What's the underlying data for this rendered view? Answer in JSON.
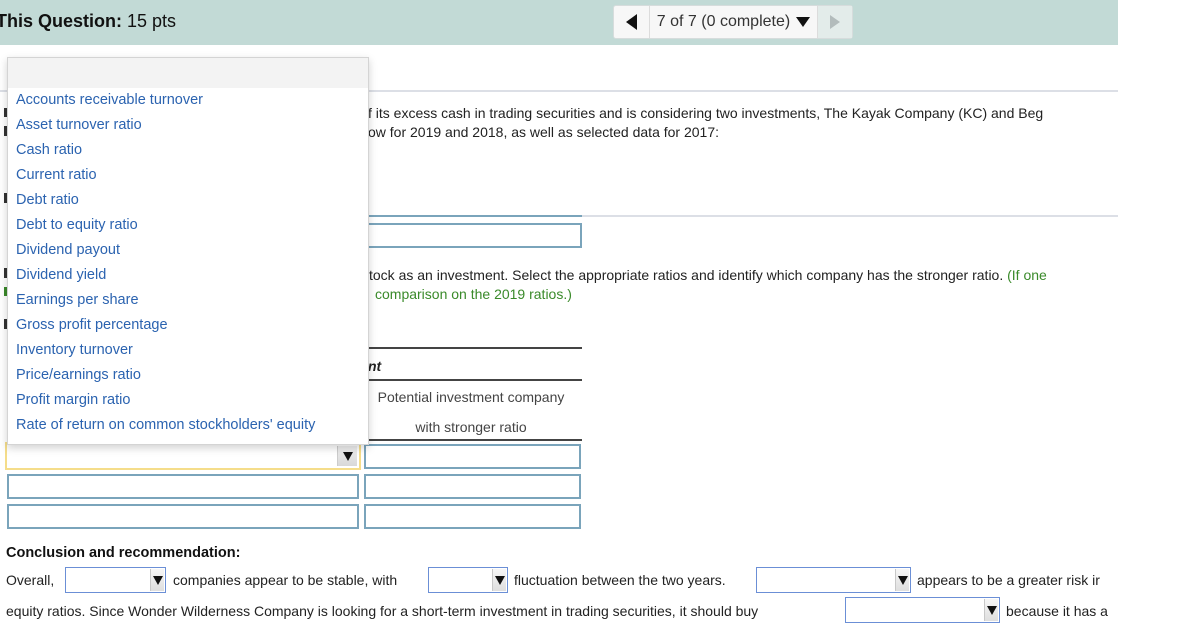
{
  "header": {
    "question_label": "This Question:",
    "points": "15 pts",
    "nav": {
      "prev_icon": "triangle-left-icon",
      "counter": "7 of 7 (0 complete)",
      "counter_icon": "triangle-down-icon",
      "next_icon": "triangle-right-icon"
    }
  },
  "intro": {
    "line1": "f its excess cash in trading securities and is considering two investments, The Kayak Company (KC) and Beg",
    "line2": "ow for 2019 and 2018, as well as selected data for 2017:"
  },
  "instruction": {
    "main": "tock as an investment. Select the appropriate ratios and identify which company has the stronger ratio.",
    "note_start": "(If one",
    "note_cont": "comparison on the 2019 ratios.)"
  },
  "table": {
    "header_fragment": "nt",
    "col2_line1": "Potential investment company",
    "col2_line2": "with stronger ratio",
    "rows": [
      {
        "ratio": "",
        "company": ""
      },
      {
        "ratio": "",
        "company": ""
      },
      {
        "ratio": "",
        "company": ""
      }
    ]
  },
  "ratio_dropdown": {
    "open": true,
    "selected": "",
    "options": [
      "Accounts receivable turnover",
      "Asset turnover ratio",
      "Cash ratio",
      "Current ratio",
      "Debt ratio",
      "Debt to equity ratio",
      "Dividend payout",
      "Dividend yield",
      "Earnings per share",
      "Gross profit percentage",
      "Inventory turnover",
      "Price/earnings ratio",
      "Profit margin ratio",
      "Rate of return on common stockholders' equity"
    ]
  },
  "conclusion": {
    "title": "Conclusion and recommendation:",
    "line1": {
      "t1": "Overall,",
      "t2": "companies appear to be stable, with",
      "t3": "fluctuation between the two years.",
      "t4": "appears to be a greater risk ir"
    },
    "line2": {
      "t1": "equity ratios. Since Wonder Wilderness Company is looking for a short-term investment in trading securities, it should buy",
      "t2": "because it has a"
    },
    "selects": [
      "",
      "",
      "",
      ""
    ]
  },
  "colors": {
    "header_bg": "#c2dad6",
    "option_text": "#2b63b0",
    "note_green": "#3a8a2a",
    "input_border": "#7aa4bb",
    "focused_select_border": "#f5dd8a"
  }
}
